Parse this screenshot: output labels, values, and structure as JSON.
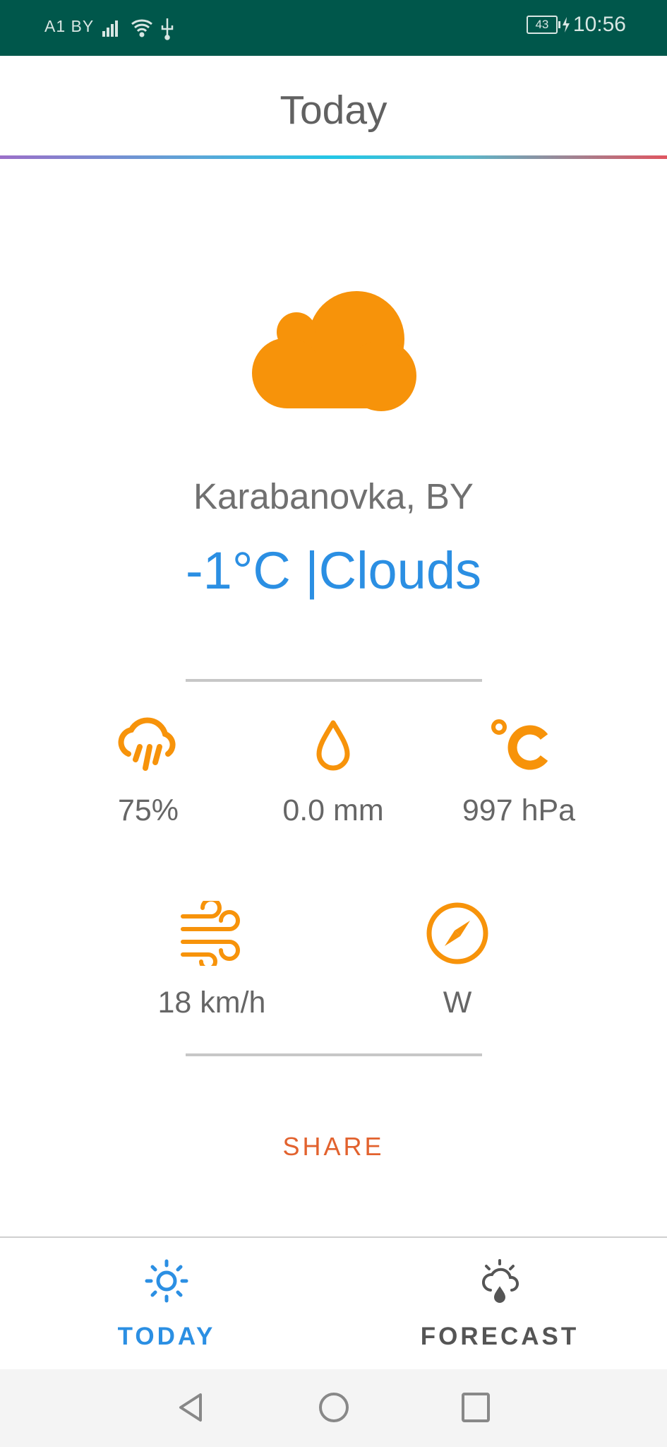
{
  "status_bar": {
    "carrier": "A1 BY",
    "battery": "43",
    "time": "10:56"
  },
  "header": {
    "title": "Today"
  },
  "current": {
    "condition_icon": "cloud-icon",
    "location": "Karabanovka, BY",
    "summary": "-1°C |Clouds"
  },
  "stats": {
    "humidity": {
      "icon": "rain-cloud-icon",
      "value": "75%"
    },
    "precipitation": {
      "icon": "water-drop-icon",
      "value": "0.0 mm"
    },
    "pressure": {
      "icon": "celsius-icon",
      "value": "997 hPa"
    },
    "wind_speed": {
      "icon": "wind-icon",
      "value": "18 km/h"
    },
    "wind_direction": {
      "icon": "compass-icon",
      "value": "W"
    }
  },
  "actions": {
    "share_label": "SHARE"
  },
  "bottom_nav": {
    "today_label": "TODAY",
    "forecast_label": "FORECAST"
  },
  "colors": {
    "status_bar": "#00574b",
    "accent_blue": "#2b8fe3",
    "icon_orange": "#f7930a",
    "share_red": "#e2622e",
    "text_gray": "#666666"
  }
}
